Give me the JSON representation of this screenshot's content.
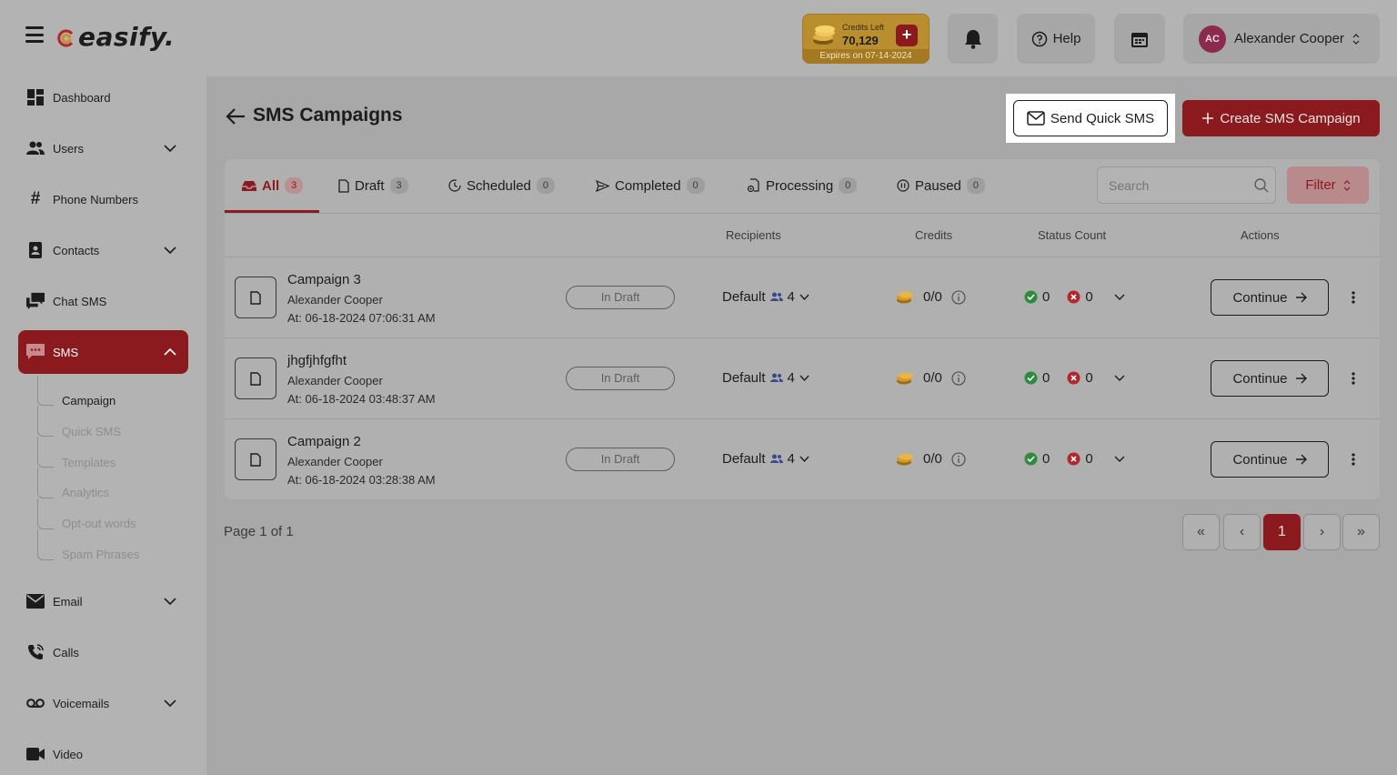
{
  "header": {
    "logo_text": "easify.",
    "credits_label": "Credits Left",
    "credits_value": "70,129",
    "credits_plus": "+",
    "credits_expiry": "Expires on 07-14-2024",
    "help_label": "Help",
    "user_initials": "AC",
    "user_name": "Alexander Cooper"
  },
  "sidebar": {
    "items": [
      {
        "label": "Dashboard",
        "icon": "dashboard-icon"
      },
      {
        "label": "Users",
        "icon": "users-icon"
      },
      {
        "label": "Phone Numbers",
        "icon": "hash-icon"
      },
      {
        "label": "Contacts",
        "icon": "contacts-icon"
      },
      {
        "label": "Chat SMS",
        "icon": "chat-icon"
      },
      {
        "label": "SMS",
        "icon": "sms-icon"
      },
      {
        "label": "Email",
        "icon": "email-icon"
      },
      {
        "label": "Calls",
        "icon": "phone-icon"
      },
      {
        "label": "Voicemails",
        "icon": "voicemail-icon"
      },
      {
        "label": "Video",
        "icon": "video-icon"
      }
    ],
    "sms_sub": [
      "Campaign",
      "Quick SMS",
      "Templates",
      "Analytics",
      "Opt-out words",
      "Spam Phrases"
    ]
  },
  "main": {
    "title": "SMS Campaigns",
    "quick_sms_label": "Send Quick SMS",
    "create_label": "Create SMS Campaign",
    "tabs": [
      {
        "label": "All",
        "count": "3"
      },
      {
        "label": "Draft",
        "count": "3"
      },
      {
        "label": "Scheduled",
        "count": "0"
      },
      {
        "label": "Completed",
        "count": "0"
      },
      {
        "label": "Processing",
        "count": "0"
      },
      {
        "label": "Paused",
        "count": "0"
      }
    ],
    "search_placeholder": "Search",
    "filter_label": "Filter",
    "columns": [
      "Recipients",
      "Credits",
      "Status Count",
      "Actions"
    ],
    "rows": [
      {
        "name": "Campaign 3",
        "owner": "Alexander Cooper",
        "at": "At: 06-18-2024 07:06:31 AM",
        "status": "In Draft",
        "recipients": "Default",
        "recipient_count": "4",
        "credits": "0/0",
        "ok": "0",
        "fail": "0",
        "action": "Continue"
      },
      {
        "name": "jhgfjhfgfht",
        "owner": "Alexander Cooper",
        "at": "At: 06-18-2024 03:48:37 AM",
        "status": "In Draft",
        "recipients": "Default",
        "recipient_count": "4",
        "credits": "0/0",
        "ok": "0",
        "fail": "0",
        "action": "Continue"
      },
      {
        "name": "Campaign 2",
        "owner": "Alexander Cooper",
        "at": "At: 06-18-2024 03:28:38 AM",
        "status": "In Draft",
        "recipients": "Default",
        "recipient_count": "4",
        "credits": "0/0",
        "ok": "0",
        "fail": "0",
        "action": "Continue"
      }
    ],
    "page_info": "Page 1 of 1",
    "pager": {
      "first": "«",
      "prev": "‹",
      "current": "1",
      "next": "›",
      "last": "»"
    }
  },
  "colors": {
    "accent": "#8b1a1f",
    "success": "#2e8b3e",
    "danger": "#b3262b"
  }
}
